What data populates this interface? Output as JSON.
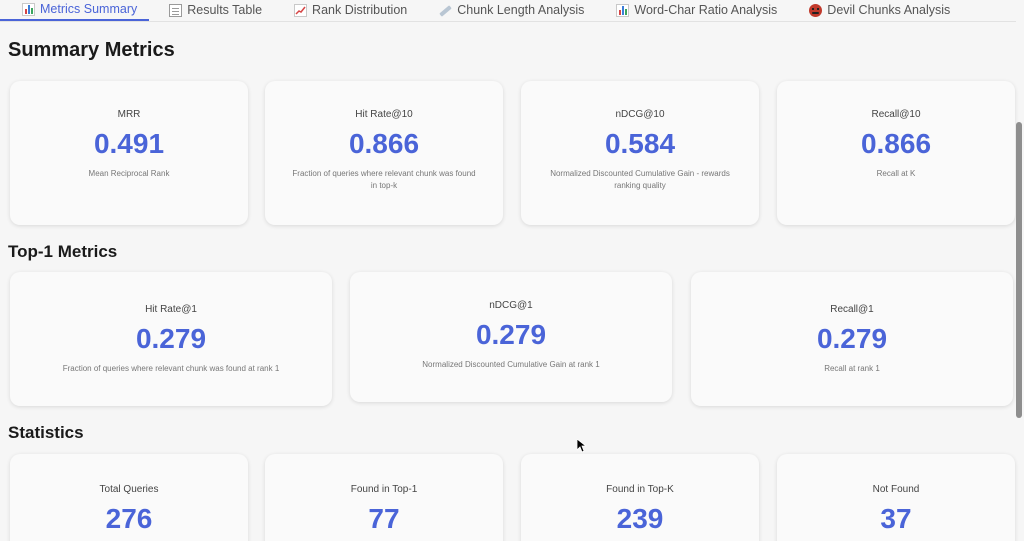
{
  "tabs": [
    {
      "label": "Metrics Summary",
      "icon": "bar-chart-icon",
      "active": true
    },
    {
      "label": "Results Table",
      "icon": "table-icon"
    },
    {
      "label": "Rank Distribution",
      "icon": "line-chart-icon"
    },
    {
      "label": "Chunk Length Analysis",
      "icon": "ruler-icon"
    },
    {
      "label": "Word-Char Ratio Analysis",
      "icon": "bar-chart-icon"
    },
    {
      "label": "Devil Chunks Analysis",
      "icon": "devil-icon"
    }
  ],
  "sections": {
    "summary": {
      "title": "Summary Metrics",
      "cards": [
        {
          "label": "MRR",
          "value": "0.491",
          "desc": "Mean Reciprocal Rank"
        },
        {
          "label": "Hit Rate@10",
          "value": "0.866",
          "desc": "Fraction of queries where relevant chunk was found in top-k"
        },
        {
          "label": "nDCG@10",
          "value": "0.584",
          "desc": "Normalized Discounted Cumulative Gain - rewards ranking quality"
        },
        {
          "label": "Recall@10",
          "value": "0.866",
          "desc": "Recall at K"
        }
      ]
    },
    "top1": {
      "title": "Top-1 Metrics",
      "cards": [
        {
          "label": "Hit Rate@1",
          "value": "0.279",
          "desc": "Fraction of queries where relevant chunk was found at rank 1"
        },
        {
          "label": "nDCG@1",
          "value": "0.279",
          "desc": "Normalized Discounted Cumulative Gain at rank 1"
        },
        {
          "label": "Recall@1",
          "value": "0.279",
          "desc": "Recall at rank 1"
        }
      ]
    },
    "stats": {
      "title": "Statistics",
      "cards": [
        {
          "label": "Total Queries",
          "value": "276"
        },
        {
          "label": "Found in Top-1",
          "value": "77"
        },
        {
          "label": "Found in Top-K",
          "value": "239"
        },
        {
          "label": "Not Found",
          "value": "37"
        }
      ]
    }
  },
  "colors": {
    "accent": "#4a64d8",
    "background": "#f6f6f6",
    "card": "#fafafa"
  }
}
